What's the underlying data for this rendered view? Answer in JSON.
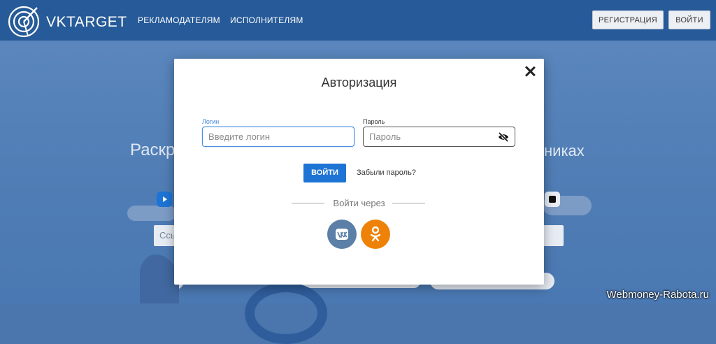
{
  "header": {
    "logo_text": "VKTARGET",
    "nav": [
      "РЕКЛАМОДАТЕЛЯМ",
      "ИСПОЛНИТЕЛЯМ"
    ],
    "register_label": "РЕГИСТРАЦИЯ",
    "login_label": "ВОЙТИ"
  },
  "background": {
    "hero_left": "Раскр",
    "hero_right": "никах",
    "input_text": "Ссь"
  },
  "modal": {
    "title": "Авторизация",
    "login_label": "Логин",
    "login_placeholder": "Введите логин",
    "password_label": "Пароль",
    "password_placeholder": "Пароль",
    "submit_label": "ВОЙТИ",
    "forgot_label": "Забыли пароль?",
    "via_label": "Войти через",
    "social": [
      "vk-icon",
      "odnoklassniki-icon"
    ]
  },
  "colors": {
    "header_bg": "#265a98",
    "primary_button": "#1e74d4",
    "vk": "#5b7fa6",
    "ok": "#ee8208",
    "focus_border": "#4a8fe0"
  },
  "watermark": "Webmoney-Rabota.ru"
}
